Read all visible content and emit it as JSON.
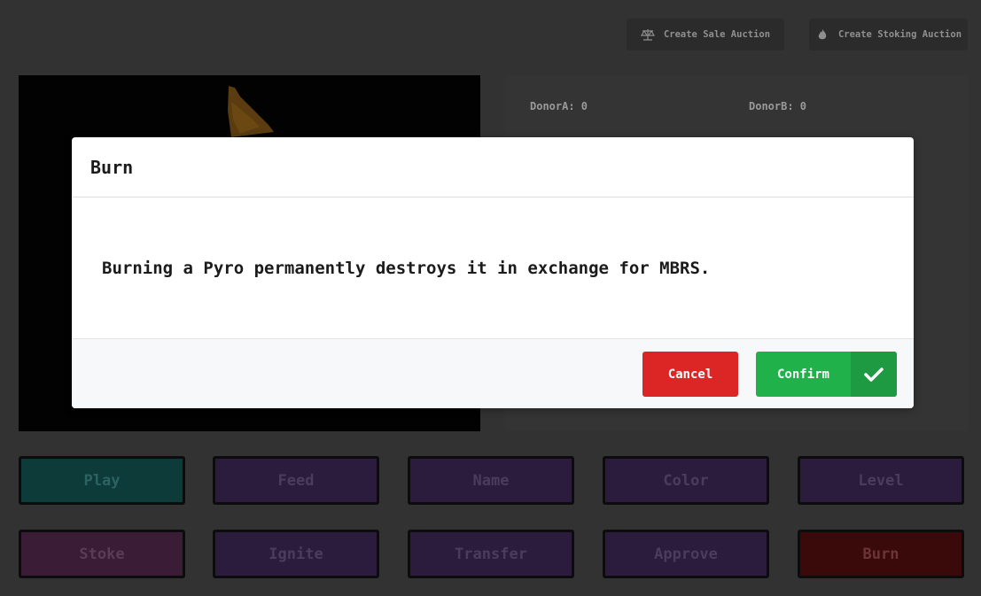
{
  "toolbar": {
    "sale_auction_label": "Create Sale Auction",
    "stoking_auction_label": "Create Stoking Auction",
    "sale_icon": "scale-icon",
    "stoking_icon": "flame-icon"
  },
  "stats": {
    "donor_a": "DonorA: 0",
    "donor_b": "DonorB: 0"
  },
  "actions": {
    "row1": [
      "Play",
      "Feed",
      "Name",
      "Color",
      "Level"
    ],
    "row2": [
      "Stoke",
      "Ignite",
      "Transfer",
      "Approve",
      "Burn"
    ]
  },
  "modal": {
    "title": "Burn",
    "message": "Burning a Pyro permanently destroys it in exchange for MBRS.",
    "cancel_label": "Cancel",
    "confirm_label": "Confirm",
    "confirm_icon": "check-icon"
  },
  "colors": {
    "cancel": "#dc2626",
    "confirm": "#21b14b"
  }
}
